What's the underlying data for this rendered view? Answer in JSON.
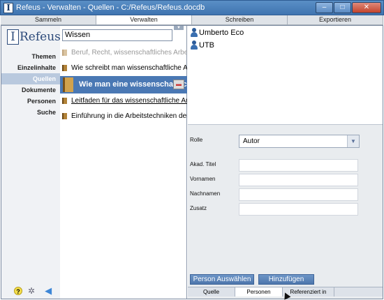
{
  "window": {
    "title": "Refeus - Verwalten - Quellen - C:/Refeus/Refeus.docdb",
    "app_icon_letter": "I",
    "controls": [
      "–",
      "□",
      "✕"
    ]
  },
  "tabs": [
    {
      "label": "Sammeln",
      "active": false
    },
    {
      "label": "Verwalten",
      "active": true
    },
    {
      "label": "Schreiben",
      "active": false
    },
    {
      "label": "Exportieren",
      "active": false
    }
  ],
  "sidebar": {
    "logo_bracket": "I",
    "logo_text": "Refeus",
    "items": [
      {
        "label": "Themen",
        "active": false
      },
      {
        "label": "Einzelinhalte",
        "active": false
      },
      {
        "label": "Quellen",
        "active": true
      },
      {
        "label": "Dokumente",
        "active": false
      },
      {
        "label": "Personen",
        "active": false
      },
      {
        "label": "Suche",
        "active": false
      }
    ],
    "icons": {
      "help": "?",
      "settings": "✲",
      "back": "◀"
    }
  },
  "sources": {
    "search_value": "Wissen",
    "items": [
      {
        "label": "Beruf, Recht, wissenschaftliches Arbeiten",
        "state": "faded"
      },
      {
        "label": "Wie schreibt man wissenschaftliche Arbeiten",
        "state": "normal"
      },
      {
        "label": "Wie man eine wissenschaftliche Arbeit schreibt",
        "state": "selected"
      },
      {
        "label": "Leitfaden für das wissenschaftliche Arbeiten",
        "state": "underlined"
      },
      {
        "label": "Einführung in die Arbeitstechniken der Politikwissenschaft",
        "state": "normal"
      }
    ]
  },
  "persons": [
    "Umberto Eco",
    "UTB"
  ],
  "form": {
    "role_label": "Rolle",
    "role_value": "Autor",
    "title_label": "Akad. Titel",
    "firstname_label": "Vornamen",
    "lastname_label": "Nachnamen",
    "suffix_label": "Zusatz"
  },
  "buttons": {
    "select_person": "Person Auswählen",
    "add": "Hinzufügen"
  },
  "bottom_tabs": [
    {
      "label": "Quelle",
      "active": false
    },
    {
      "label": "Personen",
      "active": true
    },
    {
      "label": "Referenziert in",
      "active": false
    }
  ]
}
